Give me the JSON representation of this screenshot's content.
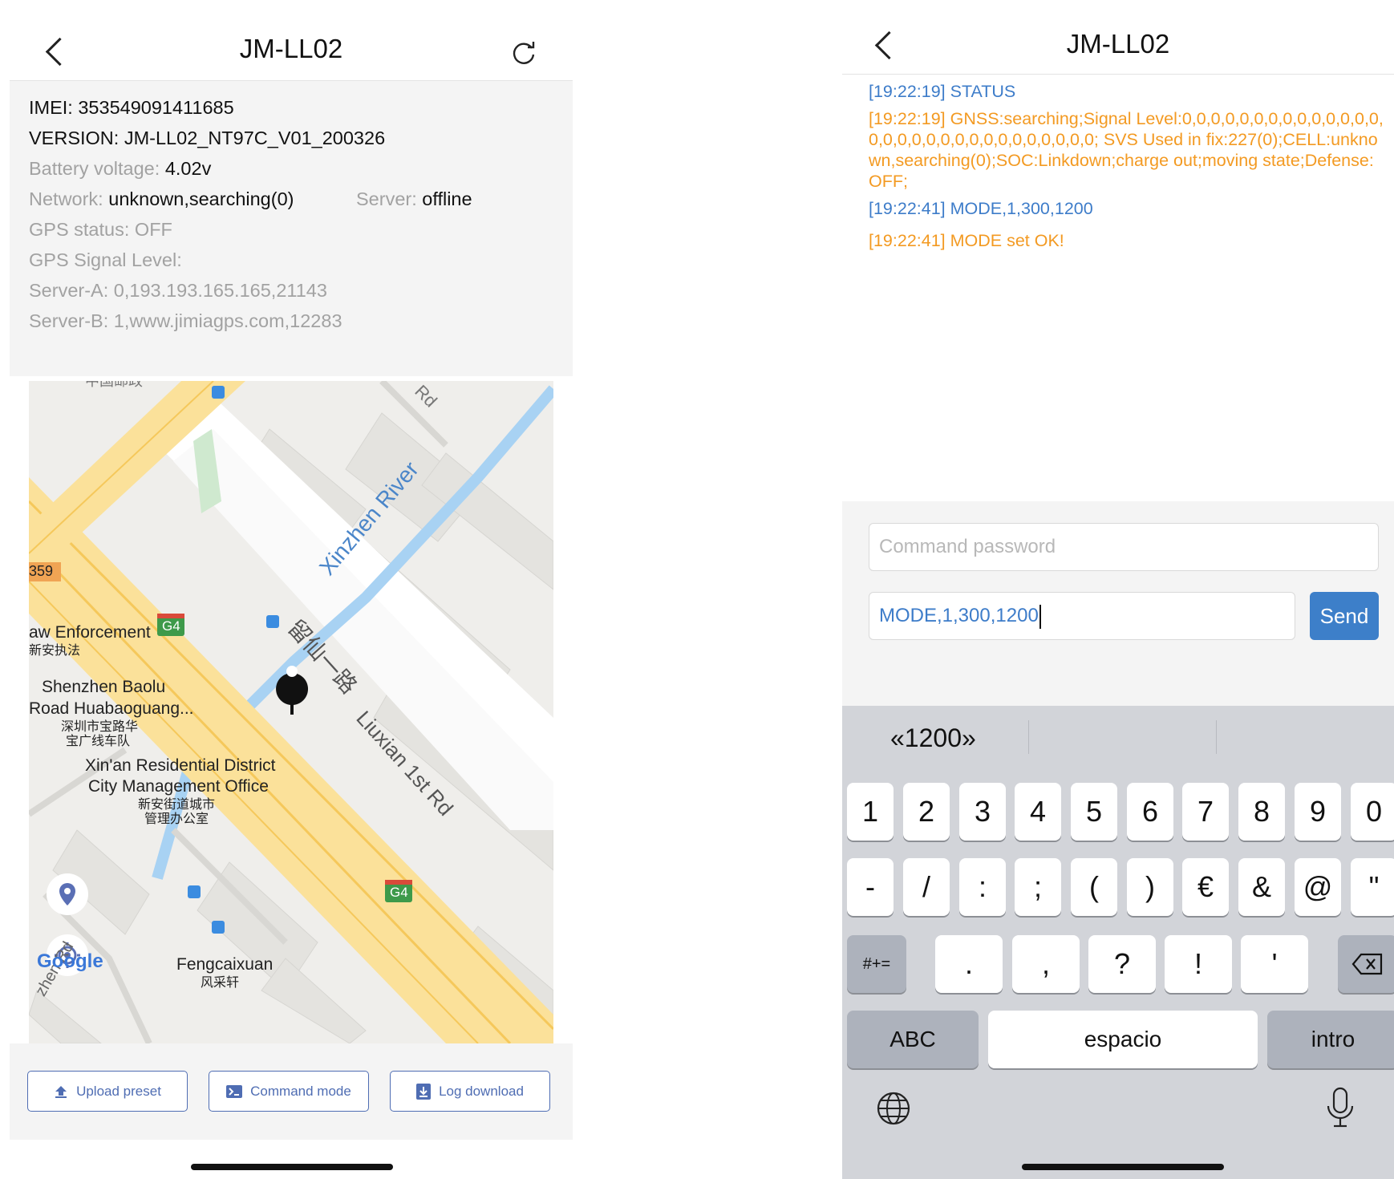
{
  "left_screen": {
    "title": "JM-LL02",
    "info": {
      "imei": "IMEI: 353549091411685",
      "version": "VERSION: JM-LL02_NT97C_V01_200326",
      "battery_label": "Battery voltage: ",
      "battery_value": "4.02v",
      "network_label": "Network: ",
      "network_value": "unknown,searching(0)",
      "server_label": "Server: ",
      "server_value": "offline",
      "gps_status": "GPS status: OFF",
      "gps_signal": "GPS Signal Level:",
      "server_a": "Server-A: 0,193.193.165.165,21143",
      "server_b": "Server-B: 1,www.jimiagps.com,12283"
    },
    "map": {
      "labels": {
        "river": "Xinzhen River",
        "road_cn": "留仙一路",
        "road_en": "Liuxian 1st Rd",
        "rd_top": "Rd",
        "badge_359": "359",
        "law": "aw Enforcement",
        "law_cn": "新安执法",
        "baolu_1": "Shenzhen Baolu",
        "baolu_2": "Road Huabaoguang...",
        "baolu_cn_1": "深圳市宝路华",
        "baolu_cn_2": "宝广线车队",
        "xinan_1": "Xin'an Residential District",
        "xinan_2": "City Management Office",
        "xinan_cn_1": "新安街道城市",
        "xinan_cn_2": "管理办公室",
        "g4_top": "G4",
        "g4_bottom": "G4",
        "feng": "Fengcaixuan",
        "feng_cn": "风采轩",
        "zhen_rd": "zhen Rd",
        "google": "Google",
        "top_cn": "中国邮政"
      }
    },
    "buttons": {
      "upload": "Upload preset",
      "command": "Command mode",
      "log": "Log download"
    }
  },
  "right_screen": {
    "title": "JM-LL02",
    "log": [
      {
        "text": "[19:22:19] STATUS",
        "color": "#3d7cc9"
      },
      {
        "text": "[19:22:19] GNSS:searching;Signal Level:0,0,0,0,0,0,0,0,0,0,0,0,0,0,0,0,0,0,0,0,0,0,0,0,0,0,0,0,0,0; SVS Used in fix:227(0);CELL:unknown,searching(0);SOC:Linkdown;charge out;moving state;Defense:OFF;",
        "color": "#f39a22"
      },
      {
        "text": "[19:22:41] MODE,1,300,1200",
        "color": "#3d7cc9"
      },
      {
        "text": "[19:22:41] MODE set OK!",
        "color": "#f39a22"
      }
    ],
    "password_placeholder": "Command password",
    "command_value": "MODE,1,300,1200",
    "send_label": "Send",
    "keyboard": {
      "suggestion": "«1200»",
      "row1": [
        "1",
        "2",
        "3",
        "4",
        "5",
        "6",
        "7",
        "8",
        "9",
        "0"
      ],
      "row2": [
        "-",
        "/",
        ":",
        ";",
        "(",
        ")",
        "€",
        "&",
        "@",
        "\""
      ],
      "shift_label": "#+=",
      "row3": [
        ".",
        ",",
        "?",
        "!",
        "'"
      ],
      "abc_label": "ABC",
      "space_label": "espacio",
      "return_label": "intro"
    }
  }
}
